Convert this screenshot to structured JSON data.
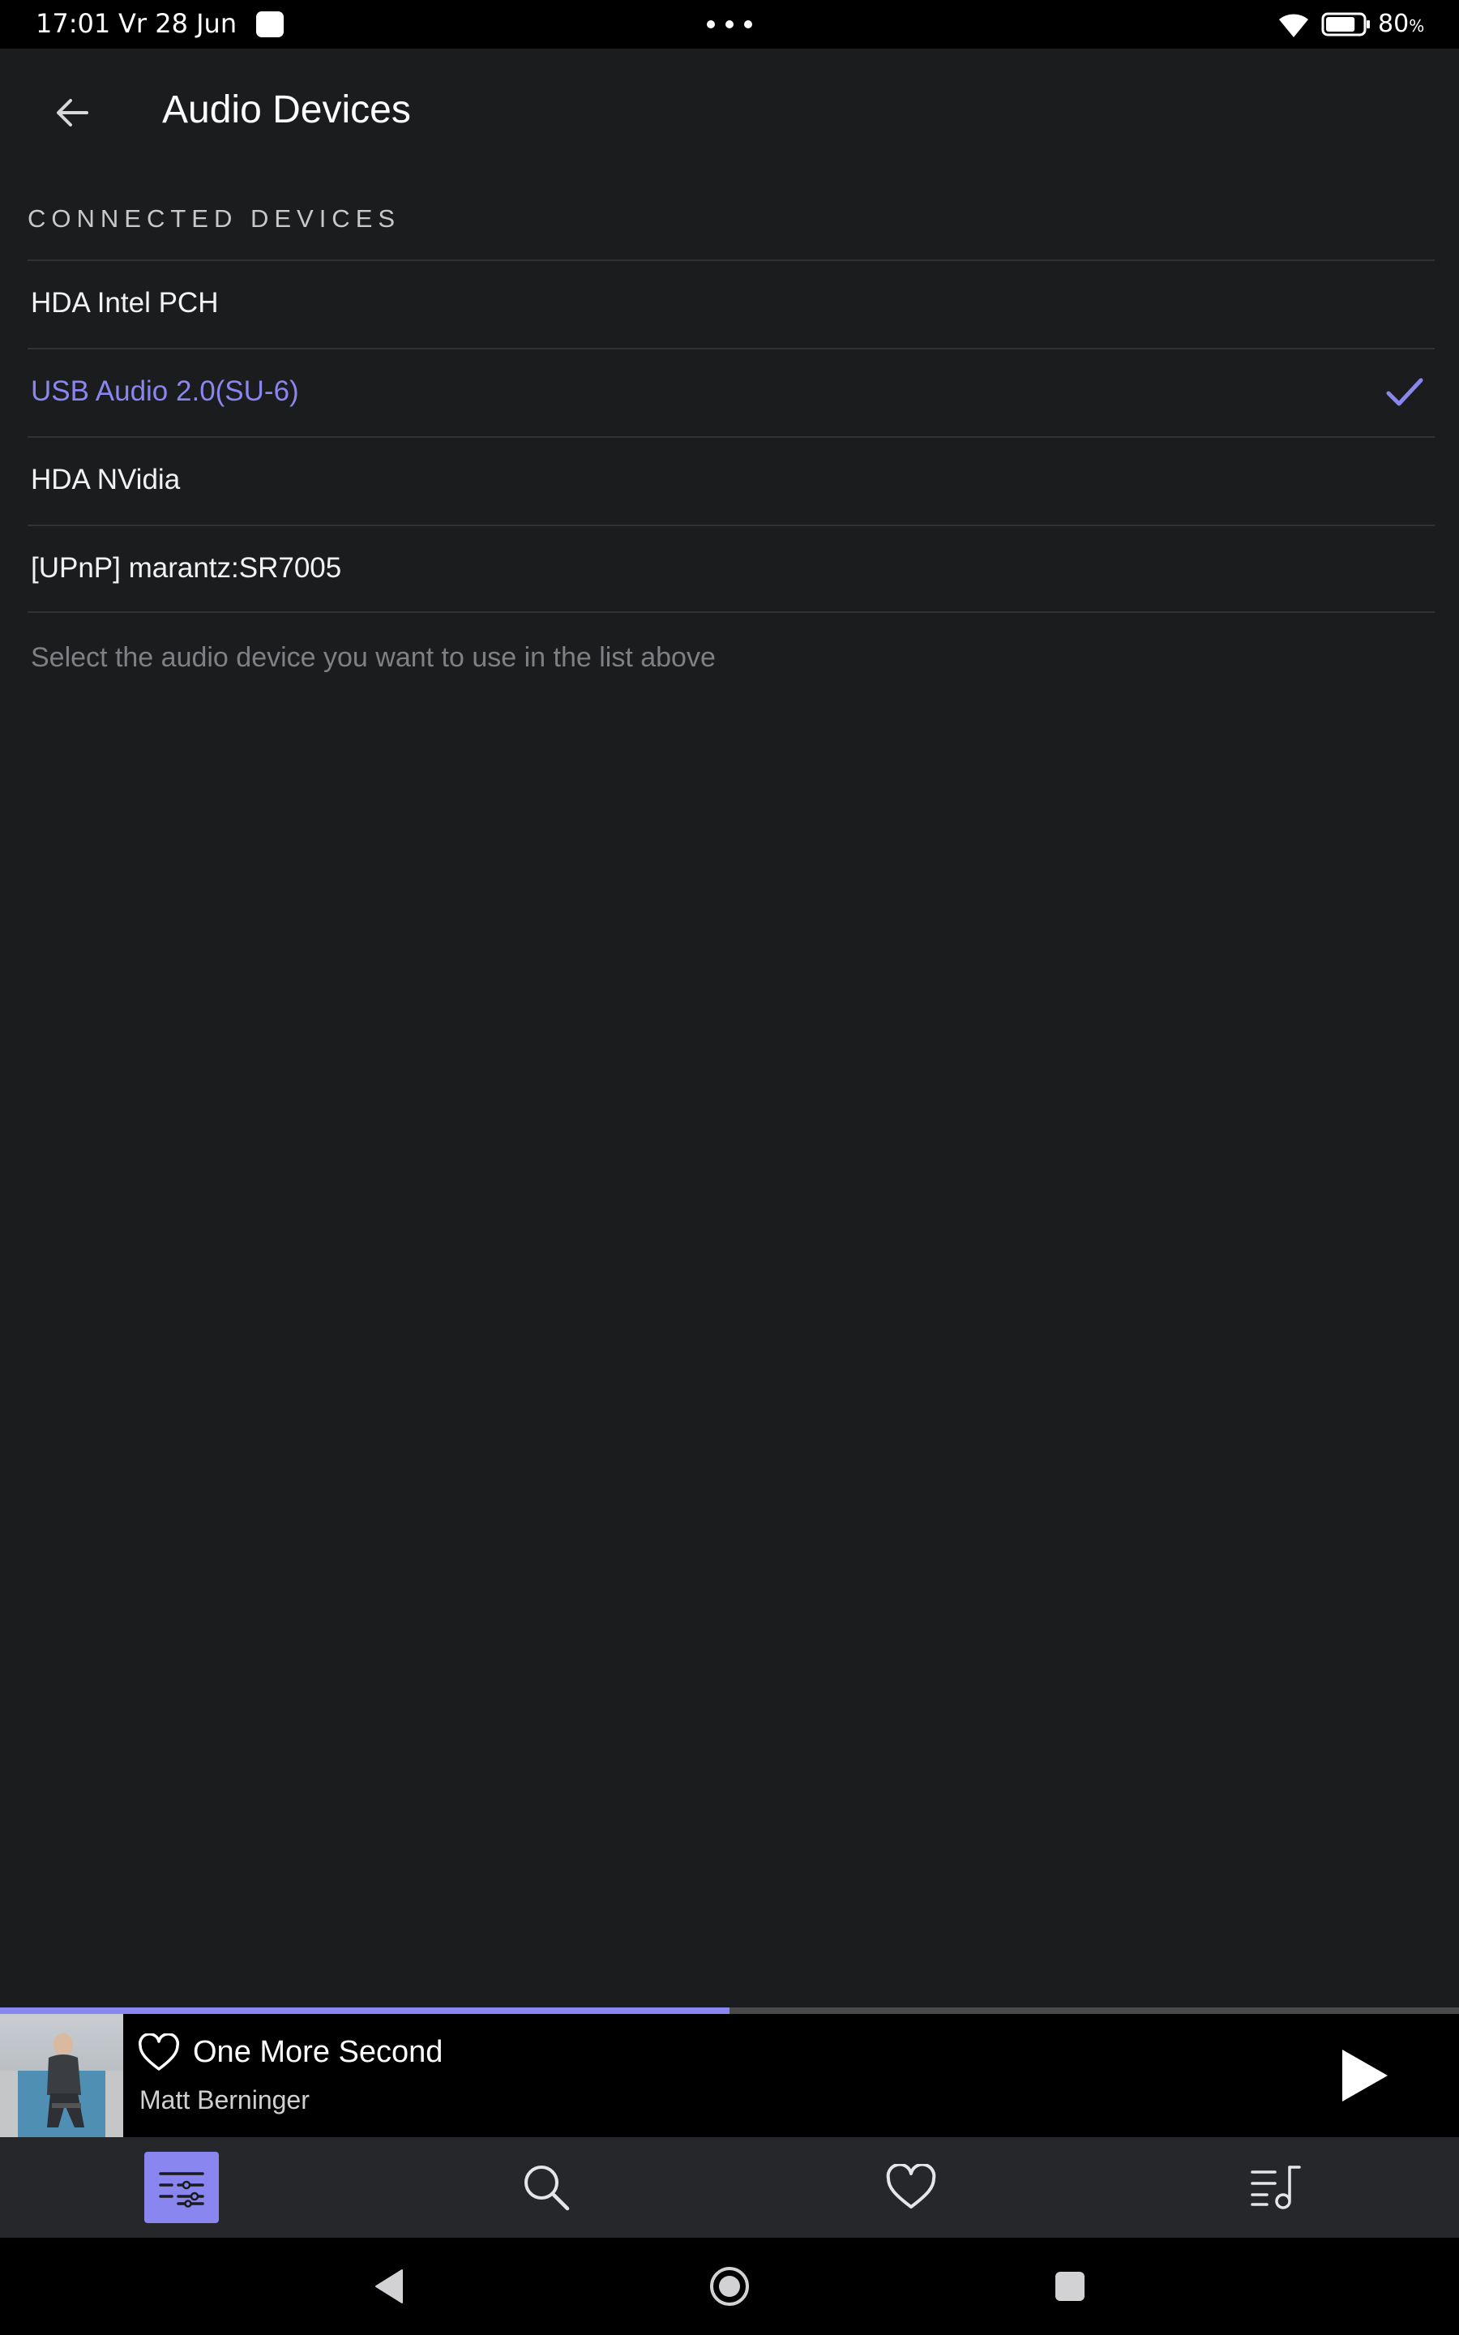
{
  "status_bar": {
    "time": "17:01",
    "date": "Vr 28 Jun",
    "battery_value": "80",
    "battery_unit": "%",
    "battery_level": 0.8
  },
  "header": {
    "title": "Audio Devices",
    "back_icon": "arrow-left-icon"
  },
  "section": {
    "header": "CONNECTED DEVICES",
    "devices": [
      {
        "label": "HDA Intel PCH",
        "selected": false
      },
      {
        "label": "USB Audio 2.0(SU-6)",
        "selected": true
      },
      {
        "label": "HDA NVidia",
        "selected": false
      },
      {
        "label": "[UPnP] marantz:SR7005",
        "selected": false
      }
    ],
    "hint": "Select the audio device you want to use in the list above"
  },
  "player": {
    "title": "One More Second",
    "artist": "Matt Berninger",
    "progress": 0.5
  },
  "bottom_nav": {
    "items": [
      {
        "icon": "library-settings-icon",
        "active": true
      },
      {
        "icon": "search-icon",
        "active": false
      },
      {
        "icon": "heart-icon",
        "active": false
      },
      {
        "icon": "queue-music-icon",
        "active": false
      }
    ]
  },
  "colors": {
    "accent": "#8a86ef",
    "background": "#1b1c1e",
    "divider": "#313235",
    "nav_background": "#26272a",
    "hint_text": "#7f8083"
  }
}
